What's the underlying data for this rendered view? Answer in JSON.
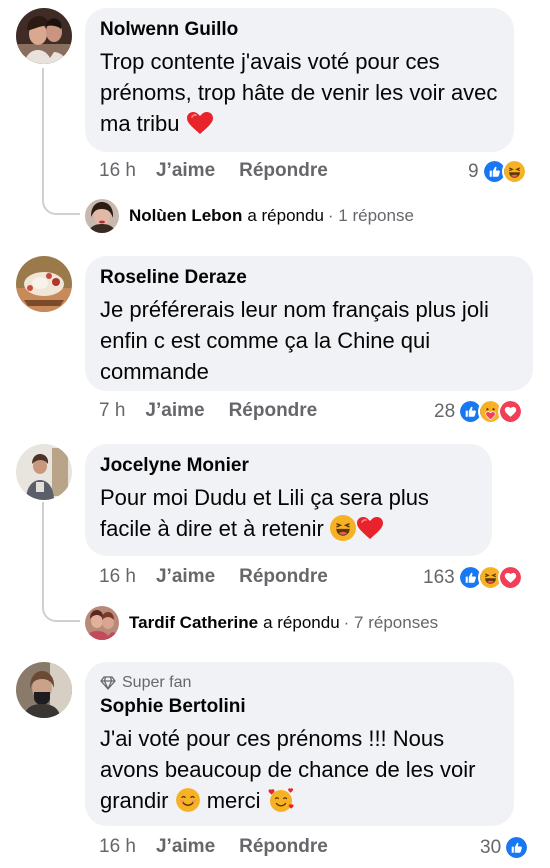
{
  "comments": [
    {
      "author": "Nolwenn Guillo",
      "text": "Trop contente j'avais voté pour ces prénoms, trop hâte de venir les voir avec ma tribu",
      "time": "16 h",
      "like_label": "J’aime",
      "reply_label": "Répondre",
      "reaction_count": "9",
      "reactions": [
        "like-icon",
        "haha-icon"
      ],
      "reply_summary": {
        "name": "Nolùen Lebon",
        "verb": "a répondu",
        "count": "· 1 réponse"
      }
    },
    {
      "author": "Roseline Deraze",
      "text": "Je préférerais leur  nom français plus joli enfin c est comme ça la Chine qui commande",
      "time": "7 h",
      "like_label": "J’aime",
      "reply_label": "Répondre",
      "reaction_count": "28",
      "reactions": [
        "like-icon",
        "care-icon",
        "love-icon"
      ]
    },
    {
      "author": "Jocelyne Monier",
      "text": "Pour moi Dudu et Lili ça sera plus facile à dire et à retenir",
      "time": "16 h",
      "like_label": "J’aime",
      "reply_label": "Répondre",
      "reaction_count": "163",
      "reactions": [
        "like-icon",
        "haha-icon",
        "love-icon"
      ],
      "reply_summary": {
        "name": "Tardif Catherine",
        "verb": "a répondu",
        "count": "· 7 réponses"
      }
    },
    {
      "badge": "Super fan",
      "author": "Sophie Bertolini",
      "text_part1": "J'ai voté pour ces prénoms !!! Nous avons beaucoup de chance de les voir grandir",
      "text_part2": "merci",
      "time": "16 h",
      "like_label": "J’aime",
      "reply_label": "Répondre",
      "reaction_count": "30",
      "reactions": [
        "like-icon"
      ]
    }
  ],
  "colors": {
    "like": "#1877f2",
    "love": "#f33e58",
    "haha": "#f7b125",
    "bubble": "#f0f2f5",
    "meta": "#65676b"
  }
}
